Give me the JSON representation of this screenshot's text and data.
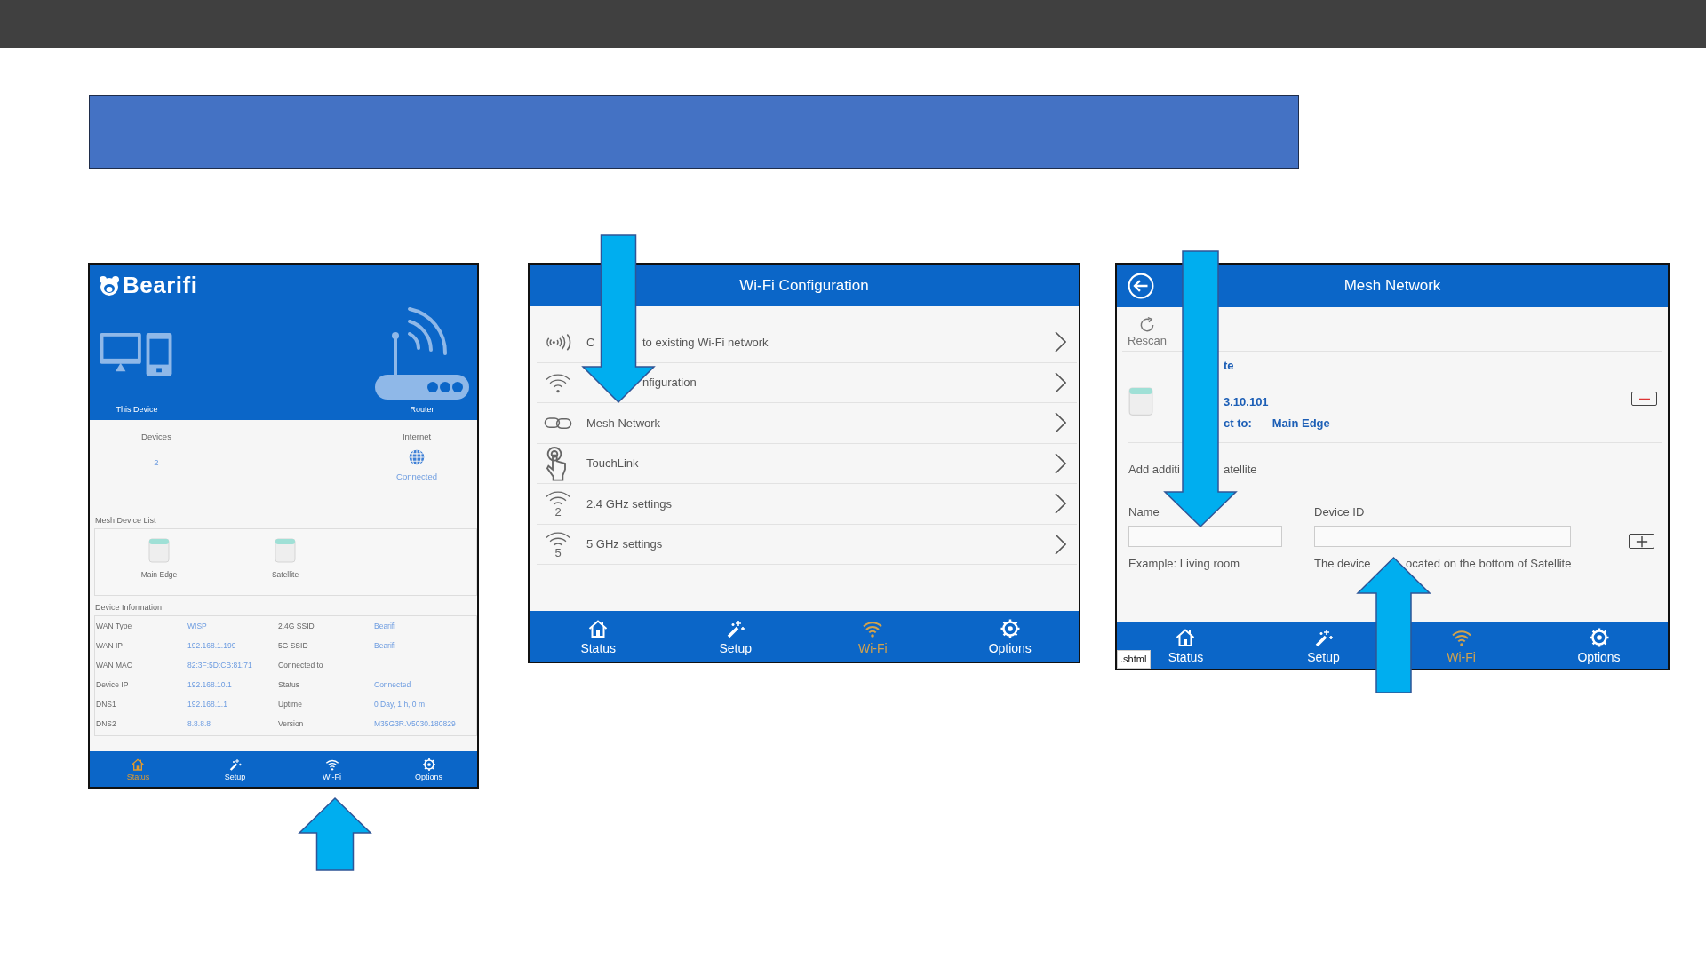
{
  "status_screen": {
    "logo": "Bearifi",
    "this_device": "This Device",
    "router": "Router",
    "devices_label": "Devices",
    "devices_count": "2",
    "internet_label": "Internet",
    "internet_status": "Connected",
    "mesh_list_title": "Mesh Device List",
    "mesh_devices": [
      {
        "label": "Main Edge"
      },
      {
        "label": "Satellite"
      }
    ],
    "info_title": "Device Information",
    "info_rows": [
      [
        {
          "label": "WAN Type",
          "value": "WISP"
        },
        {
          "label": "2.4G SSID",
          "value": "Bearifi"
        }
      ],
      [
        {
          "label": "WAN IP",
          "value": "192.168.1.199"
        },
        {
          "label": "5G SSID",
          "value": "Bearifi"
        }
      ],
      [
        {
          "label": "WAN MAC",
          "value": "82:3F:5D:CB:81:71"
        },
        {
          "label": "Connected to"
        }
      ],
      [
        {
          "label": "Device IP",
          "value": "192.168.10.1"
        },
        {
          "label": "Status",
          "value": "Connected"
        }
      ],
      [
        {
          "label": "DNS1",
          "value": "192.168.1.1"
        },
        {
          "label": "Uptime",
          "value": "0 Day, 1 h, 0 m"
        }
      ],
      [
        {
          "label": "DNS2",
          "value": "8.8.8.8"
        },
        {
          "label": "Version",
          "value": "M35G3R.V5030.180829"
        }
      ]
    ],
    "nav": [
      {
        "label": "Status",
        "selected": true
      },
      {
        "label": "Setup",
        "selected": false
      },
      {
        "label": "Wi-Fi",
        "selected": false
      },
      {
        "label": "Options",
        "selected": false
      }
    ]
  },
  "wifi_config_screen": {
    "title": "Wi-Fi Configuration",
    "items": [
      {
        "label": [
          "C",
          "to existing Wi-Fi network"
        ]
      },
      {
        "label": [
          "nfiguration"
        ],
        "covered": true
      },
      {
        "label": [
          "Mesh Network"
        ]
      },
      {
        "label": [
          "TouchLink"
        ]
      },
      {
        "label": [
          "2.4 GHz settings"
        ],
        "badge": "2"
      },
      {
        "label": [
          "5 GHz settings"
        ],
        "badge": "5"
      }
    ],
    "nav": [
      {
        "label": "Status",
        "selected": false
      },
      {
        "label": "Setup",
        "selected": false
      },
      {
        "label": "Wi-Fi",
        "selected": true
      },
      {
        "label": "Options",
        "selected": false
      }
    ]
  },
  "mesh_screen": {
    "title": "Mesh Network",
    "rescan": "Rescan",
    "device": {
      "name": "te",
      "ip": "3.10.101",
      "connect_label": "ct to:",
      "connect_value": "Main Edge"
    },
    "add_title": [
      "Add additi",
      "atellite"
    ],
    "fields": [
      {
        "label": "Name",
        "hint": [
          "Example: Living room"
        ]
      },
      {
        "label": "Device ID",
        "hint": [
          "The device",
          "ocated on the bottom of Satellite"
        ]
      }
    ],
    "tooltip": ".shtml",
    "nav": [
      {
        "label": "Status",
        "selected": false
      },
      {
        "label": "Setup",
        "selected": false
      },
      {
        "label": "Wi-Fi",
        "selected": true
      },
      {
        "label": "Options",
        "selected": false
      }
    ]
  }
}
